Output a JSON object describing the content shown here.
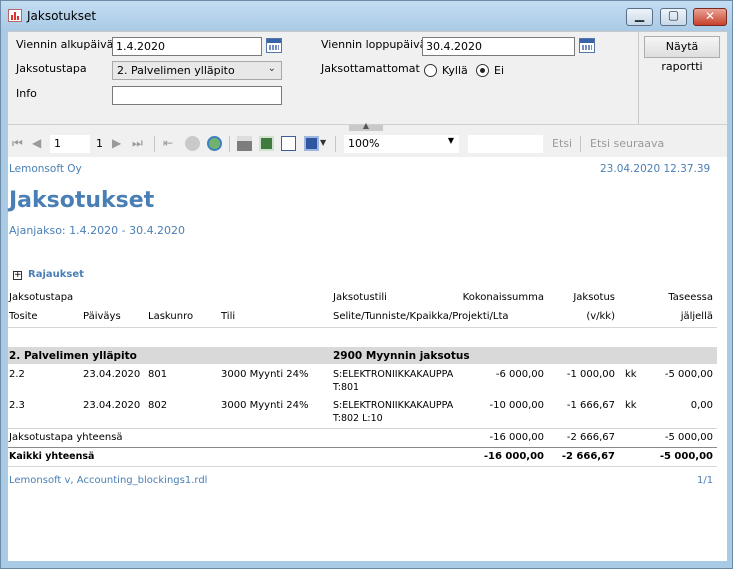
{
  "window": {
    "title": "Jaksotukset",
    "min_icon": "minimize-icon",
    "max_icon": "maximize-icon",
    "close_icon": "close-icon"
  },
  "form": {
    "start_label": "Viennin alkupäivä",
    "start_value": "1.4.2020",
    "end_label": "Viennin loppupäivä",
    "end_value": "30.4.2020",
    "method_label": "Jaksotustapa",
    "method_value": "2. Palvelimen ylläpito",
    "unperiodized_label": "Jaksottamattomat",
    "opt_yes": "Kyllä",
    "opt_no": "Ei",
    "selected": "Ei",
    "info_label": "Info",
    "info_value": "",
    "show_report": "Näytä raportti"
  },
  "toolbar": {
    "page_current": "1",
    "page_total": "1",
    "zoom": "100%",
    "search_value": "",
    "find": "Etsi",
    "find_next": "Etsi seuraava"
  },
  "report": {
    "company": "Lemonsoft Oy",
    "timestamp": "23.04.2020 12.37.39",
    "title": "Jaksotukset",
    "period": "Ajanjakso: 1.4.2020 - 30.4.2020",
    "restrictions": "Rajaukset",
    "headers": {
      "method": "Jaksotustapa",
      "voucher": "Tosite",
      "date": "Päiväys",
      "invoice": "Laskunro",
      "account": "Tili",
      "accrual_account": "Jaksotustili",
      "desc": "Selite/Tunniste/Kpaikka/Projekti/Lta",
      "total": "Kokonaissumma",
      "accrual": "Jaksotus",
      "accrual_unit": "(v/kk)",
      "balance": "Taseessa",
      "balance_sub": "jäljellä"
    },
    "group": {
      "name": "2. Palvelimen ylläpito",
      "account": "2900 Myynnin jaksotus"
    },
    "rows": [
      {
        "voucher": "2.2",
        "date": "23.04.2020",
        "invoice": "801",
        "account": "3000 Myynti 24%",
        "desc1": "S:ELEKTRONIIKKAKAUPPA",
        "desc2": "T:801",
        "total": "-6 000,00",
        "accrual": "-1 000,00",
        "unit": "kk",
        "balance": "-5 000,00"
      },
      {
        "voucher": "2.3",
        "date": "23.04.2020",
        "invoice": "802",
        "account": "3000 Myynti 24%",
        "desc1": "S:ELEKTRONIIKKAKAUPPA",
        "desc2": "T:802 L:10",
        "total": "-10 000,00",
        "accrual": "-1 666,67",
        "unit": "kk",
        "balance": "0,00"
      }
    ],
    "subtotal": {
      "label": "Jaksotustapa yhteensä",
      "total": "-16 000,00",
      "accrual": "-2 666,67",
      "balance": "-5 000,00"
    },
    "grand_total": {
      "label": "Kaikki yhteensä",
      "total": "-16 000,00",
      "accrual": "-2 666,67",
      "balance": "-5 000,00"
    },
    "footer_left": "Lemonsoft v, Accounting_blockings1.rdl",
    "footer_right": "1/1"
  }
}
